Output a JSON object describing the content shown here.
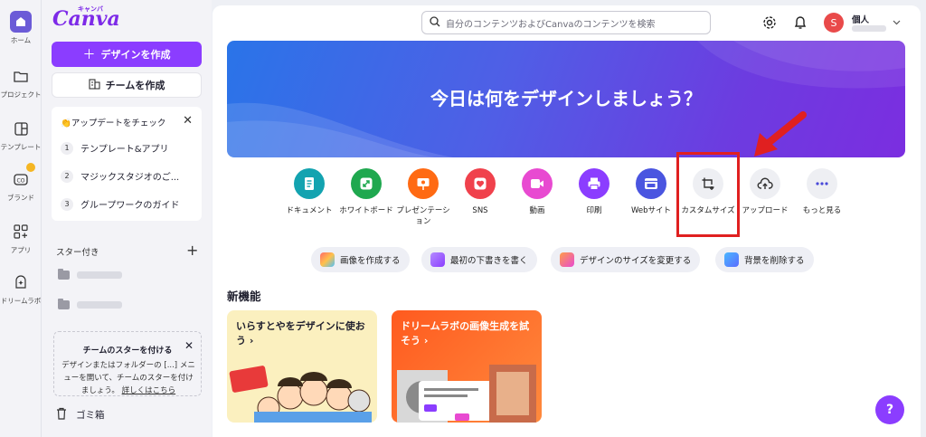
{
  "rail": {
    "items": [
      {
        "label": "ホーム"
      },
      {
        "label": "プロジェクト"
      },
      {
        "label": "テンプレート"
      },
      {
        "label": "ブランド"
      },
      {
        "label": "アプリ"
      },
      {
        "label": "ドリームラボ"
      }
    ]
  },
  "sidebar": {
    "logo": "Canva",
    "logo_kana": "キャンバ",
    "create_design": "デザインを作成",
    "create_team": "チームを作成",
    "updates": {
      "title": "👏アップデートをチェック",
      "items": [
        {
          "num": "1",
          "label": "テンプレート&アプリ"
        },
        {
          "num": "2",
          "label": "マジックスタジオのご..."
        },
        {
          "num": "3",
          "label": "グループワークのガイド"
        }
      ]
    },
    "starred_title": "スター付き",
    "team_star": {
      "title": "チームのスターを付ける",
      "body": "デザインまたはフォルダーの [...] メニューを開いて、チームのスターを付けましょう。",
      "link": "詳しくはこちら"
    },
    "trash": "ゴミ箱"
  },
  "header": {
    "search_placeholder": "自分のコンテンツおよびCanvaのコンテンツを検索",
    "avatar_initial": "S",
    "account_label": "個人"
  },
  "hero": {
    "title": "今日は何をデザインしましょう？"
  },
  "categories": [
    {
      "label": "ドキュメント",
      "color": "#13a3b0"
    },
    {
      "label": "ホワイトボード",
      "color": "#1fa84f"
    },
    {
      "label": "プレゼンテーション",
      "color": "#ff6a13"
    },
    {
      "label": "SNS",
      "color": "#f0414c"
    },
    {
      "label": "動画",
      "color": "#e84ad1"
    },
    {
      "label": "印刷",
      "color": "#8b3dff"
    },
    {
      "label": "Webサイト",
      "color": "#4a55e0"
    },
    {
      "label": "カスタムサイズ",
      "color": "#eeeff3"
    },
    {
      "label": "アップロード",
      "color": "#eeeff3"
    },
    {
      "label": "もっと見る",
      "color": "#eeeff3"
    }
  ],
  "chips": [
    {
      "label": "画像を作成する"
    },
    {
      "label": "最初の下書きを書く"
    },
    {
      "label": "デザインのサイズを変更する"
    },
    {
      "label": "背景を削除する"
    }
  ],
  "new_features": {
    "title": "新機能",
    "cards": [
      {
        "title": "いらすとやをデザインに使おう ›"
      },
      {
        "title": "ドリームラボの画像生成を試そう ›"
      }
    ]
  },
  "help": "?"
}
